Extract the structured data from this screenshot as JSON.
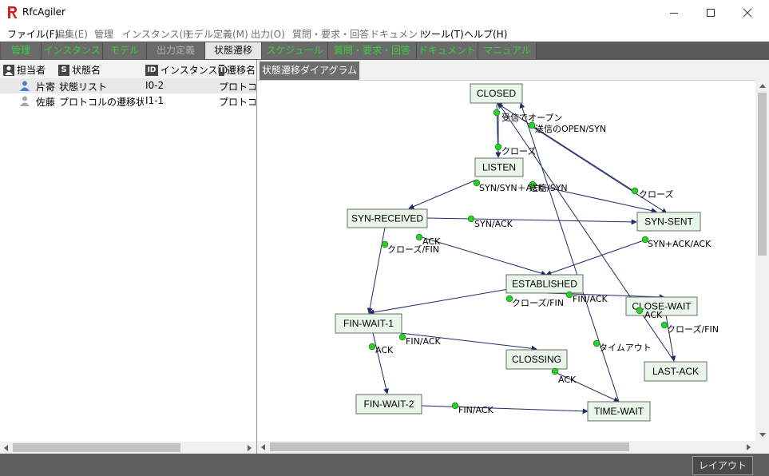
{
  "window": {
    "title": "RfcAgiler"
  },
  "menu": [
    {
      "label": "ファイル(F)",
      "enabled": true
    },
    {
      "label": "編集(E)",
      "enabled": false
    },
    {
      "label": "管理",
      "enabled": false
    },
    {
      "label": "インスタンス(I)",
      "enabled": false
    },
    {
      "label": "モデル定義(M)",
      "enabled": false
    },
    {
      "label": "出力(O)",
      "enabled": false
    },
    {
      "label": "質問・要求・回答",
      "enabled": false
    },
    {
      "label": "ドキュメント",
      "enabled": false
    },
    {
      "label": "ツール(T)",
      "enabled": true
    },
    {
      "label": "ヘルプ(H)",
      "enabled": true
    }
  ],
  "tabs": [
    {
      "label": "管理",
      "state": "green"
    },
    {
      "label": "インスタンス",
      "state": "green"
    },
    {
      "label": "モデル",
      "state": "green"
    },
    {
      "label": "出力定義",
      "state": "dim"
    },
    {
      "label": "状態遷移",
      "state": "active"
    },
    {
      "label": "スケジュール",
      "state": "green"
    },
    {
      "label": "質問・要求・回答",
      "state": "green"
    },
    {
      "label": "ドキュメント",
      "state": "green"
    },
    {
      "label": "マニュアル",
      "state": "green"
    }
  ],
  "left_table": {
    "columns": [
      {
        "icon": "person-header-icon",
        "glyph": "",
        "label": "担当者"
      },
      {
        "icon": "state-s-icon",
        "glyph": "S",
        "label": "状態名"
      },
      {
        "icon": "id-icon",
        "glyph": "ID",
        "label": "インスタンスID"
      },
      {
        "icon": "transition-t-icon",
        "glyph": "T",
        "label": "遷移名"
      }
    ],
    "rows": [
      {
        "owner": "片寄",
        "owner_color": "#4a7fd0",
        "state": "状態リスト",
        "instance_id": "I0-2",
        "transition": "プロトコル"
      },
      {
        "owner": "佐藤",
        "owner_color": "#a8a8a8",
        "state": "プロトコルの遷移状態",
        "instance_id": "I1-1",
        "transition": "プロトコル"
      }
    ]
  },
  "diagram": {
    "tab_label": "状態遷移ダイアグラム",
    "nodes": [
      {
        "id": "closed",
        "label": "CLOSED"
      },
      {
        "id": "listen",
        "label": "LISTEN"
      },
      {
        "id": "synrcv",
        "label": "SYN-RECEIVED"
      },
      {
        "id": "synsent",
        "label": "SYN-SENT"
      },
      {
        "id": "estab",
        "label": "ESTABLISHED"
      },
      {
        "id": "closewait",
        "label": "CLOSE-WAIT"
      },
      {
        "id": "fin1",
        "label": "FIN-WAIT-1"
      },
      {
        "id": "closing",
        "label": "CLOSSING"
      },
      {
        "id": "lastack",
        "label": "LAST-ACK"
      },
      {
        "id": "fin2",
        "label": "FIN-WAIT-2"
      },
      {
        "id": "timewait",
        "label": "TIME-WAIT"
      }
    ],
    "edges": [
      {
        "from": "closed",
        "to": "listen",
        "label": "受信でオープン"
      },
      {
        "from": "closed",
        "to": "synsent",
        "label": "送信のOPEN/SYN"
      },
      {
        "from": "listen",
        "to": "closed",
        "label": "クローズ"
      },
      {
        "from": "listen",
        "to": "synrcv",
        "label": "SYN/SYN＋ACK"
      },
      {
        "from": "listen",
        "to": "synsent",
        "label": "送信/SYN"
      },
      {
        "from": "synsent",
        "to": "closed",
        "label": "クローズ"
      },
      {
        "from": "synrcv",
        "to": "synsent",
        "label": "SYN/ACK"
      },
      {
        "from": "synrcv",
        "to": "estab",
        "label": "ACK"
      },
      {
        "from": "synrcv",
        "to": "fin1",
        "label": "クローズ/FIN"
      },
      {
        "from": "synsent",
        "to": "estab",
        "label": "SYN+ACK/ACK"
      },
      {
        "from": "estab",
        "to": "fin1",
        "label": "クローズ/FIN"
      },
      {
        "from": "estab",
        "to": "closewait",
        "label": "FIN/ACK"
      },
      {
        "from": "closewait",
        "to": "lastack",
        "label": "クローズ/FIN"
      },
      {
        "from": "lastack",
        "to": "closed",
        "label": "ACK"
      },
      {
        "from": "fin1",
        "to": "closing",
        "label": "FIN/ACK"
      },
      {
        "from": "fin1",
        "to": "fin2",
        "label": "ACK"
      },
      {
        "from": "closing",
        "to": "timewait",
        "label": "ACK"
      },
      {
        "from": "fin2",
        "to": "timewait",
        "label": "FIN/ACK"
      },
      {
        "from": "timewait",
        "to": "closed",
        "label": "タイムアウト"
      }
    ]
  },
  "statusbar": {
    "layout_button": "レイアウト"
  }
}
